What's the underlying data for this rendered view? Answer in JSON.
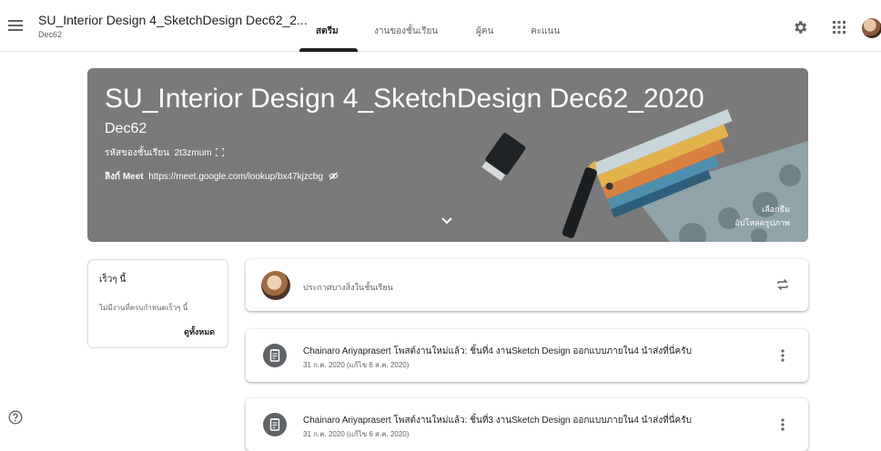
{
  "header": {
    "class_title": "SU_Interior Design 4_SketchDesign Dec62_2...",
    "class_section": "Dec62",
    "tabs": [
      {
        "label": "สตรีม",
        "active": true
      },
      {
        "label": "งานของชั้นเรียน",
        "active": false
      },
      {
        "label": "ผู้คน",
        "active": false
      },
      {
        "label": "คะแนน",
        "active": false
      }
    ],
    "icons": [
      "menu-icon",
      "gear-icon",
      "apps-icon",
      "avatar"
    ]
  },
  "banner": {
    "title": "SU_Interior Design 4_SketchDesign Dec62_2020",
    "section": "Dec62",
    "code_label": "รหัสของชั้นเรียน",
    "code_value": "2t3zmum",
    "meet_label": "ลิงก์ Meet",
    "meet_url": "https://meet.google.com/lookup/bx47kjzcbg",
    "select_theme": "เลือกธีม",
    "upload_photo": "อัปโหลดรูปภาพ"
  },
  "upcoming": {
    "title": "เร็วๆ นี้",
    "empty_text": "ไม่มีงานที่ครบกำหนดเร็วๆ นี้",
    "view_all": "ดูทั้งหมด"
  },
  "announce": {
    "placeholder": "ประกาศบางสิ่งในชั้นเรียน"
  },
  "posts": [
    {
      "title": "Chainaro Ariyaprasert โพสต์งานใหม่แล้ว: ชิ้นที่4 งานSketch Design ออกแบบภายใน4 นำส่งที่นี่ครับ",
      "date": "31 ก.ค. 2020 (แก้ไข 6 ส.ค. 2020)"
    },
    {
      "title": "Chainaro Ariyaprasert โพสต์งานใหม่แล้ว: ชิ้นที่3 งานSketch Design ออกแบบภายใน4 นำส่งที่นี่ครับ",
      "date": "31 ก.ค. 2020 (แก้ไข 6 ส.ค. 2020)"
    }
  ],
  "colors": {
    "banner_bg": "#7a7a7a",
    "text_primary": "#202124",
    "text_secondary": "#5f6368"
  }
}
